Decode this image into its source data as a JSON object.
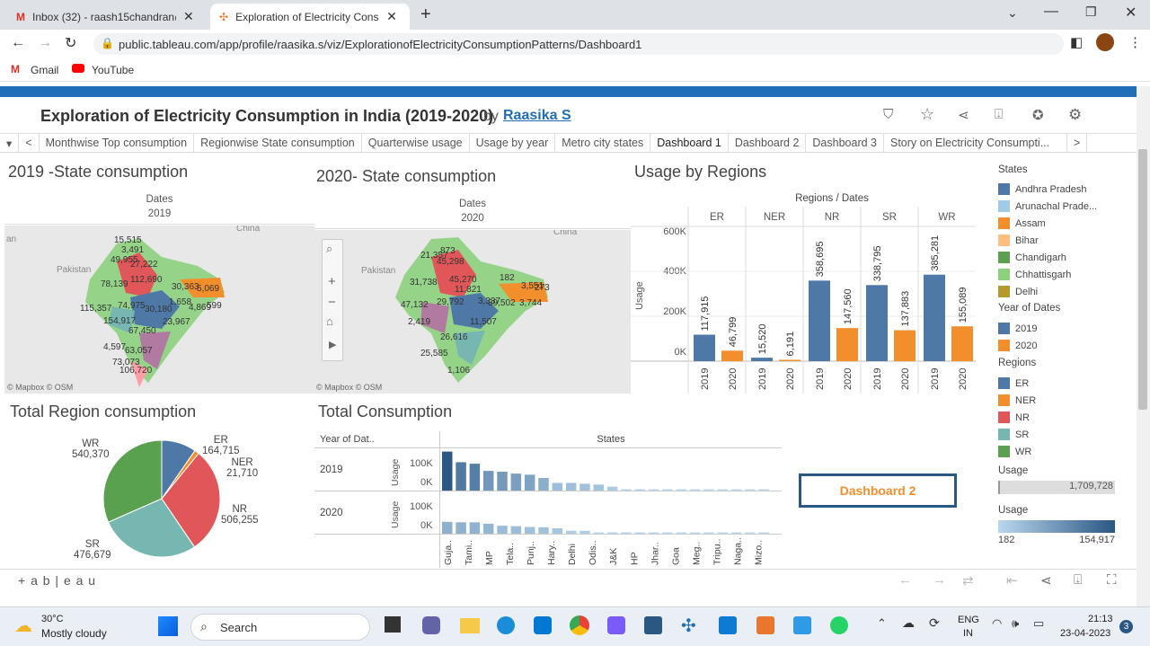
{
  "browser": {
    "tabs": [
      {
        "label": "Inbox (32) - raash15chandran@g",
        "icon": "gmail-icon"
      },
      {
        "label": "Exploration of Electricity Consum",
        "icon": "tableau-icon"
      }
    ],
    "url": "public.tableau.com/app/profile/raasika.s/viz/ExplorationofElectricityConsumptionPatterns/Dashboard1",
    "bookmarks": [
      "Gmail",
      "YouTube"
    ]
  },
  "viz": {
    "title": "Exploration of Electricity Consumption in India (2019-2020)",
    "by": "by",
    "author": "Raasika S"
  },
  "sheet_tabs": [
    "Monthwise Top consumption",
    "Regionwise State consumption",
    "Quarterwise usage",
    "Usage by year",
    "Metro city states",
    "Dashboard 1",
    "Dashboard 2",
    "Dashboard 3",
    "Story on Electricity Consumpti..."
  ],
  "active_tab": "Dashboard 1",
  "map2019": {
    "title": "2019 -State consumption",
    "hdr": "Dates",
    "year": "2019",
    "credit": "© Mapbox  © OSM",
    "place_labels": [
      "an",
      "Pakistan",
      "China"
    ],
    "values": [
      "15,515",
      "3,491",
      "49,955",
      "27,222",
      "78,139",
      "112,690",
      "30,363",
      "115,357",
      "74,975",
      "154,917",
      "30,180",
      "1,658",
      "23,967",
      "67,450",
      "4,597",
      "63,057",
      "73,073",
      "106,720",
      "599",
      "5,069",
      "4,869"
    ]
  },
  "map2020": {
    "title": "2020- State consumption",
    "hdr": "Dates",
    "year": "2020",
    "credit": "© Mapbox  © OSM",
    "place_labels": [
      "Pakistan",
      "China"
    ],
    "values": [
      "873",
      "21,357",
      "45,298",
      "31,738",
      "45,270",
      "11,821",
      "47,132",
      "29,792",
      "3,337",
      "39,502",
      "3,744",
      "2,419",
      "11,507",
      "26,616",
      "25,585",
      "1,106",
      "182",
      "3,551",
      "273"
    ]
  },
  "regions_chart": {
    "title": "Usage by Regions",
    "hdr": "Regions / Dates",
    "ylabel": "Usage",
    "yticks": [
      "600K",
      "400K",
      "200K",
      "0K"
    ]
  },
  "pie": {
    "title": "Total Region consumption",
    "labels": [
      {
        "name": "WR",
        "value": "540,370"
      },
      {
        "name": "ER",
        "value": "164,715"
      },
      {
        "name": "NER",
        "value": "21,710"
      },
      {
        "name": "NR",
        "value": "506,255"
      },
      {
        "name": "SR",
        "value": "476,679"
      }
    ]
  },
  "total": {
    "title": "Total Consumption",
    "col_hdr": "Year of Dat..",
    "states_hdr": "States",
    "rows": [
      "2019",
      "2020"
    ],
    "ylabel": "Usage",
    "ticks": [
      "100K",
      "0K"
    ],
    "xlabels": [
      "Guja..",
      "Tami..",
      "MP",
      "Tela..",
      "Punj..",
      "Hary..",
      "Delhi",
      "Odis..",
      "J&K",
      "HP",
      "Jhar..",
      "Goa",
      "Meg..",
      "Tripu..",
      "Naga..",
      "Mizo.."
    ]
  },
  "dash2_button": "Dashboard 2",
  "legend": {
    "states_title": "States",
    "states": [
      "Andhra Pradesh",
      "Arunachal Prade...",
      "Assam",
      "Bihar",
      "Chandigarh",
      "Chhattisgarh",
      "Delhi"
    ],
    "states_colors": [
      "#4e79a7",
      "#a0cbe8",
      "#f28e2b",
      "#ffbe7d",
      "#59a14f",
      "#8cd17d",
      "#b6992d"
    ],
    "year_title": "Year of Dates",
    "years": [
      "2019",
      "2020"
    ],
    "year_colors": [
      "#4e79a7",
      "#f28e2b"
    ],
    "regions_title": "Regions",
    "regions": [
      "ER",
      "NER",
      "NR",
      "SR",
      "WR"
    ],
    "region_colors": [
      "#4e79a7",
      "#f28e2b",
      "#e15759",
      "#76b7b2",
      "#59a14f"
    ],
    "usage_title": "Usage",
    "usage_total": "1,709,728",
    "usage2_title": "Usage",
    "usage_min": "182",
    "usage_max": "154,917"
  },
  "tableau_logo": "+ a b | e a u",
  "taskbar": {
    "temp": "30°C",
    "weather": "Mostly cloudy",
    "search": "Search",
    "lang": "ENG",
    "lang2": "IN",
    "time": "21:13",
    "date": "23-04-2023",
    "badge": "3"
  },
  "chart_data": [
    {
      "type": "bar",
      "title": "Usage by Regions",
      "ylabel": "Usage",
      "ylim": [
        0,
        600000
      ],
      "categories": [
        "ER",
        "NER",
        "NR",
        "SR",
        "WR"
      ],
      "series": [
        {
          "name": "2019",
          "values": [
            117915,
            15520,
            358695,
            338795,
            385281
          ]
        },
        {
          "name": "2020",
          "values": [
            46799,
            6191,
            147560,
            137883,
            155089
          ]
        }
      ]
    },
    {
      "type": "pie",
      "title": "Total Region consumption",
      "categories": [
        "ER",
        "NER",
        "NR",
        "SR",
        "WR"
      ],
      "values": [
        164715,
        21710,
        506255,
        476679,
        540370
      ]
    },
    {
      "type": "bar",
      "title": "Total Consumption",
      "ylabel": "Usage",
      "ylim": [
        0,
        150000
      ],
      "categories": [
        "Guja..",
        "Tami..",
        "MP",
        "Tela..",
        "Punj..",
        "Hary..",
        "Delhi",
        "Odis..",
        "J&K",
        "HP",
        "Jhar..",
        "Goa",
        "Meg..",
        "Tripu..",
        "Naga..",
        "Mizo.."
      ],
      "series": [
        {
          "name": "2019",
          "values": [
            154917,
            112690,
            106720,
            78139,
            74975,
            67450,
            63057,
            49955,
            30363,
            30180,
            27222,
            23967,
            15515,
            5069,
            3491,
            1658
          ]
        },
        {
          "name": "2020",
          "values": [
            47132,
            45298,
            45270,
            39502,
            31738,
            29792,
            26616,
            25585,
            21357,
            11821,
            11507,
            3744,
            3551,
            3337,
            2419,
            1106
          ]
        }
      ]
    }
  ]
}
